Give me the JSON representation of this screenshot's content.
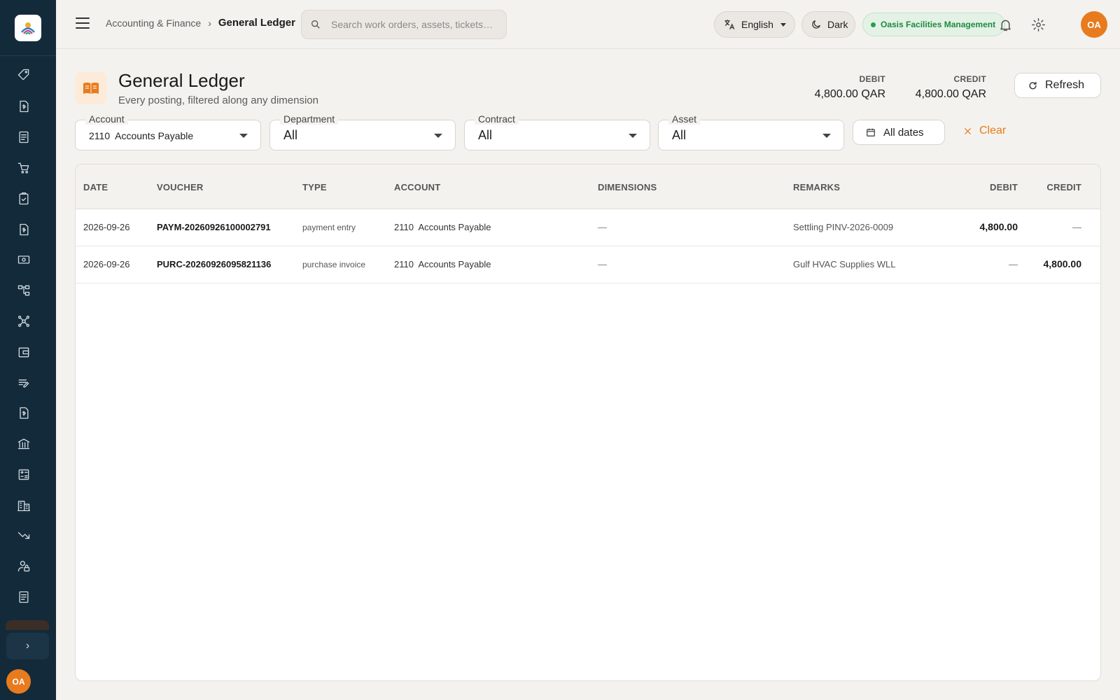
{
  "topbar": {
    "breadcrumb_parent": "Accounting & Finance",
    "breadcrumb_separator": "›",
    "breadcrumb_current": "General Ledger",
    "search_placeholder": "Search work orders, assets, tickets…",
    "language": "English",
    "theme": "Dark",
    "organization": "Oasis Facilities Management",
    "user_initials": "OA"
  },
  "sidebar": {
    "items": [
      "tag-icon",
      "invoice-icon",
      "ledger-book-icon",
      "cart-icon",
      "clipboard-check-icon",
      "receipt-icon",
      "payments-icon",
      "hierarchy-icon",
      "network-icon",
      "wallet-icon",
      "edit-notes-icon",
      "document-dollar-icon",
      "bank-icon",
      "calculator-icon",
      "building-icon",
      "trending-down-icon",
      "lock-person-icon",
      "journal-icon"
    ],
    "user_initials": "OA"
  },
  "page": {
    "title": "General Ledger",
    "subtitle": "Every posting, filtered along any dimension",
    "debit_label": "DEBIT",
    "debit_total": "4,800.00 QAR",
    "credit_label": "CREDIT",
    "credit_total": "4,800.00 QAR",
    "refresh_label": "Refresh"
  },
  "filters": {
    "account_label": "Account",
    "account_value": "2110  Accounts Payable",
    "department_label": "Department",
    "department_value": "All",
    "contract_label": "Contract",
    "contract_value": "All",
    "asset_label": "Asset",
    "asset_value": "All",
    "dates_label": "All dates",
    "clear_label": "Clear"
  },
  "table": {
    "headers": {
      "date": "DATE",
      "voucher": "VOUCHER",
      "type": "TYPE",
      "account": "ACCOUNT",
      "dimensions": "DIMENSIONS",
      "remarks": "REMARKS",
      "debit": "DEBIT",
      "credit": "CREDIT"
    },
    "rows": [
      {
        "date": "2026-09-26",
        "voucher": "PAYM-20260926100002791",
        "type": "payment entry",
        "account": "2110  Accounts Payable",
        "dimensions": "—",
        "remarks": "Settling PINV-2026-0009",
        "debit": "4,800.00",
        "credit": "—"
      },
      {
        "date": "2026-09-26",
        "voucher": "PURC-20260926095821136",
        "type": "purchase invoice",
        "account": "2110  Accounts Payable",
        "dimensions": "—",
        "remarks": "Gulf HVAC Supplies WLL",
        "debit": "—",
        "credit": "4,800.00"
      }
    ]
  },
  "colors": {
    "accent": "#e87b1e",
    "sidebar": "#132a3a",
    "background": "#f4f2ee",
    "org_badge": "#1e8a3f"
  }
}
